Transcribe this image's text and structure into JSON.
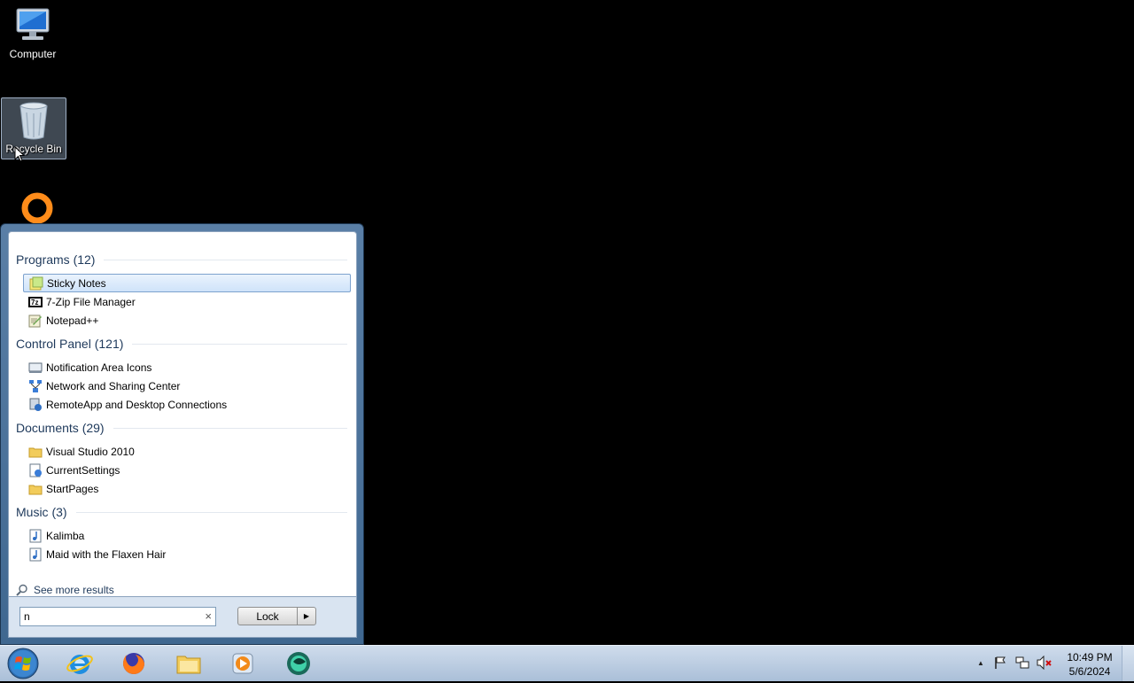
{
  "desktop": {
    "icons": [
      {
        "label": "Computer"
      },
      {
        "label": "Recycle Bin"
      }
    ]
  },
  "start_menu": {
    "groups": [
      {
        "header": "Programs (12)",
        "items": [
          "Sticky Notes",
          "7-Zip File Manager",
          "Notepad++"
        ]
      },
      {
        "header": "Control Panel (121)",
        "items": [
          "Notification Area Icons",
          "Network and Sharing Center",
          "RemoteApp and Desktop Connections"
        ]
      },
      {
        "header": "Documents (29)",
        "items": [
          "Visual Studio 2010",
          "CurrentSettings",
          "StartPages"
        ]
      },
      {
        "header": "Music (3)",
        "items": [
          "Kalimba",
          "Maid with the Flaxen Hair"
        ]
      }
    ],
    "see_more": "See more results",
    "search_value": "n",
    "lock_label": "Lock"
  },
  "taskbar": {
    "apps": [
      "internet-explorer-icon",
      "firefox-icon",
      "file-explorer-icon",
      "media-player-icon",
      "app-icon"
    ],
    "clock_time": "10:49 PM",
    "clock_date": "5/6/2024"
  },
  "colors": {
    "highlight": "#cfe3fa",
    "group_header": "#1e395b",
    "taskbar": "#bccde2"
  }
}
